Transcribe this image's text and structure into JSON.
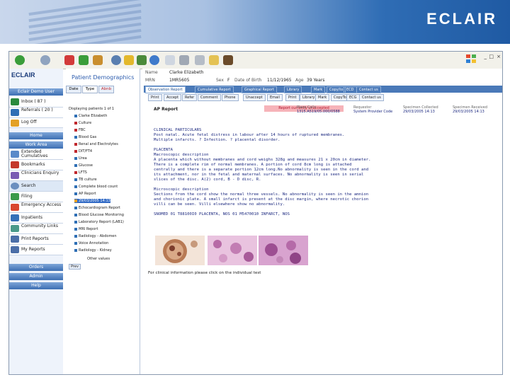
{
  "banner": {
    "brand": "ECLAIR"
  },
  "toolbar": {
    "icons": [
      "back-icon",
      "forward-icon",
      "stop-icon",
      "refresh-icon",
      "home-icon",
      "search-icon",
      "favorites-icon",
      "history-icon",
      "globe-icon",
      "mail-icon",
      "print-icon",
      "edit-icon",
      "folder-icon",
      "book-icon"
    ]
  },
  "left": {
    "logo": "ECLAIR",
    "header_demo": "Eclair Demo User",
    "inbox": "Inbox ( 87 )",
    "referrals": "Referrals ( 20 )",
    "logoff": "Log Off",
    "home": "Home",
    "work_area": "Work Area",
    "items": [
      "Extended Cumulatives",
      "Bookmarks",
      "Clinicians Enquiry",
      "Search",
      "Filing",
      "Emergency Access",
      "Inpatients",
      "Community Links",
      "Print Reports",
      "My Reports"
    ],
    "orders": "Orders",
    "admin": "Admin",
    "help": "Help"
  },
  "middle": {
    "title": "Patient Demographics",
    "tabs": [
      "Date",
      "Type",
      "Abnb"
    ],
    "displaying": "Displaying patients  1  of  1",
    "items": [
      "Clarke Elizabeth",
      "Culture",
      "FBC",
      "Blood Gas",
      "Renal and Electrolytes",
      "DIT/FT4",
      "Urea",
      "Glucose",
      "LFTS",
      "TB culture",
      "Complete blood count",
      "AP Report",
      "29/03/2005 14:13",
      "Echocardiogram Report",
      "Blood Glucose Monitoring",
      "Laboratory Report (LAB1)",
      "MRI Report",
      "Radiology - Abdomen",
      "Voice Annotation",
      "Radiology - Kidney"
    ],
    "selected": "29/03/2005 14:13",
    "other_values": "Other values",
    "prev": "Prev"
  },
  "header": {
    "name_label": "Name",
    "name_value": "Clarke Elizabeth",
    "mrn_label": "MRN",
    "mrn_value": "1MR5605",
    "sex_label": "Sex",
    "sex_value": "F",
    "dob_label": "Date of Birth",
    "dob_value": "11/12/1965",
    "age_label": "Age",
    "age_value": "39 Years"
  },
  "report_tabs": [
    "Observation Report",
    "Cumulative Report",
    "Graphical Report",
    "Library",
    "Mark",
    "Copy/to",
    "ECD",
    "Contact us"
  ],
  "buttons": [
    "Print",
    "Accept",
    "Refer",
    "Comment",
    "Phone",
    "Unaccept",
    "Email",
    "Print",
    "Library",
    "Mark",
    "CopyTo",
    "ECG",
    "Contact us"
  ],
  "report": {
    "title": "AP Report",
    "warning": "Report currently unaccepted",
    "col_headers": [
      "Place Col'n",
      "Requestor",
      "Specimen Collected",
      "Specimen Received"
    ],
    "col_values": [
      "1315.A519/05.000/0588",
      "System Provider Code",
      "29/03/2005 14:13",
      "29/03/2005 14:13"
    ],
    "lines": [
      "CLINICAL PARTICULARS",
      "Post natal. Acute fetal distress in labour after 14 hours of ruptured membranes.",
      "Multiple infarcts. ? Infection. ? placental disorder.",
      "",
      "PLACENTA",
      "Macroscopic description",
      "A placenta which without membranes and cord weighs 328g and measures 21 x 20cm in diameter.",
      "There is a complete rim of normal membranes. A portion of cord 8cm long is attached",
      "centrally and there is a separate portion 12cm long.No abnormality is seen in the cord and",
      "its attachment, nor in the fetal and maternal surfaces. No abnormality is seen in serial",
      "slices of the disc. A(2) cord, B - D disc, R.",
      "",
      "Microscopic description",
      "Sections from the cord show the normal three vessels. No abnormality is seen in the amnion",
      "and chorionic plate. A small infarct is present at the disc margin, where necrotic chorion",
      "villi can be seen. Villi elsewhere show no abnormality.",
      "",
      "SNOMED  01 T88100I0 PLACENTA, NOS 01 M5470010 INFARCT, NOS"
    ],
    "footer": "For clinical information please click on the individual test"
  }
}
